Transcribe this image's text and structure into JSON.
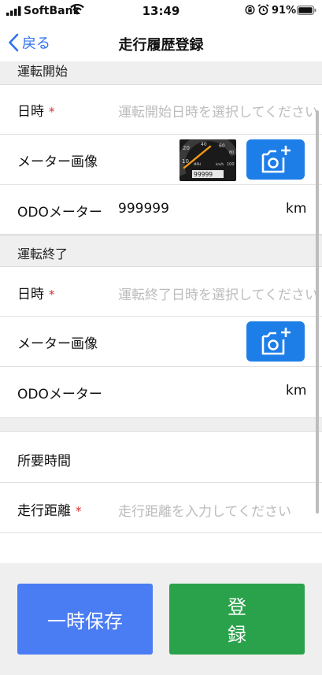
{
  "status_bar": {
    "carrier": "SoftBank",
    "time": "13:49",
    "battery": "91%"
  },
  "nav": {
    "back_label": "戻る",
    "title": "走行履歴登録"
  },
  "start_section": {
    "header": "運転開始",
    "datetime_label": "日時",
    "required_mark": "*",
    "datetime_placeholder": "運転開始日時を選択してください",
    "meter_image_label": "メーター画像",
    "odo_label": "ODOメーター",
    "odo_value": "999999",
    "odo_unit": "km"
  },
  "end_section": {
    "header": "運転終了",
    "datetime_label": "日時",
    "required_mark": "*",
    "datetime_placeholder": "運転終了日時を選択してください",
    "meter_image_label": "メーター画像",
    "odo_label": "ODOメーター",
    "odo_unit": "km"
  },
  "summary": {
    "duration_label": "所要時間",
    "distance_label": "走行距離",
    "required_mark": "*",
    "distance_placeholder": "走行距離を入力してください"
  },
  "footer": {
    "save_label": "一時保存",
    "register_label": "登録"
  },
  "colors": {
    "accent": "#2f72f0",
    "camera_button": "#1e7ee8",
    "save_button": "#4a7cf3",
    "register_button": "#2aa24b",
    "required": "#d9302f"
  }
}
